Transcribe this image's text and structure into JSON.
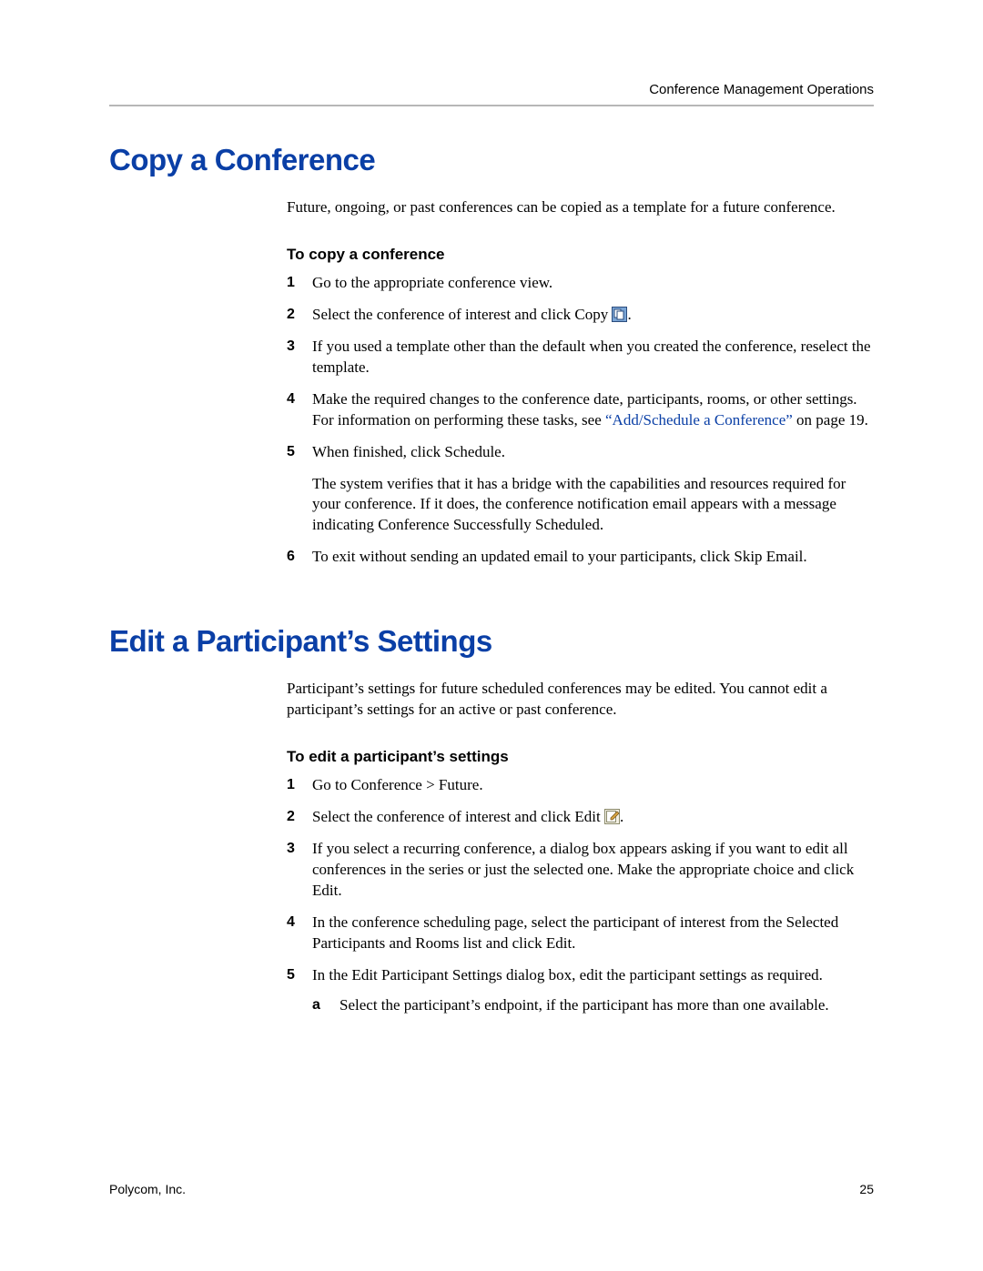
{
  "header": {
    "right": "Conference Management Operations"
  },
  "section1": {
    "title": "Copy a Conference",
    "intro": "Future, ongoing, or past conferences can be copied as a template for a future conference.",
    "subhead": "To copy a conference",
    "steps": {
      "1": "Go to the appropriate conference view.",
      "2_pre": "Select the conference of interest and click Copy ",
      "2_post": ".",
      "3": "If you used a template other than the default when you created the conference, reselect the template.",
      "4_pre": "Make the required changes to the conference date, participants, rooms, or other settings. For information on performing these tasks, see ",
      "4_link": "“Add/Schedule a Conference”",
      "4_post": " on page 19.",
      "5": "When finished, click Schedule.",
      "5_follow": "The system verifies that it has a bridge with the capabilities and resources required for your conference. If it does, the conference notification email appears with a message indicating Conference Successfully Scheduled.",
      "6": "To exit without sending an updated email to your participants, click Skip Email."
    }
  },
  "section2": {
    "title": "Edit a Participant’s Settings",
    "intro": "Participant’s settings for future scheduled conferences may be edited. You cannot edit a participant’s settings for an active or past conference.",
    "subhead": "To edit a participant’s settings",
    "steps": {
      "1": "Go to Conference > Future.",
      "2_pre": "Select the conference of interest and click Edit ",
      "2_post": ".",
      "3": "If you select a recurring conference, a dialog box appears asking if you want to edit all conferences in the series or just the selected one. Make the appropriate choice and click Edit.",
      "4": "In the conference scheduling page, select the participant of interest from the Selected Participants and Rooms list and click Edit.",
      "5": "In the Edit Participant Settings dialog box, edit the participant settings as required.",
      "5a": "Select the participant’s endpoint, if the participant has more than one available."
    }
  },
  "footer": {
    "left": "Polycom, Inc.",
    "right": "25"
  }
}
